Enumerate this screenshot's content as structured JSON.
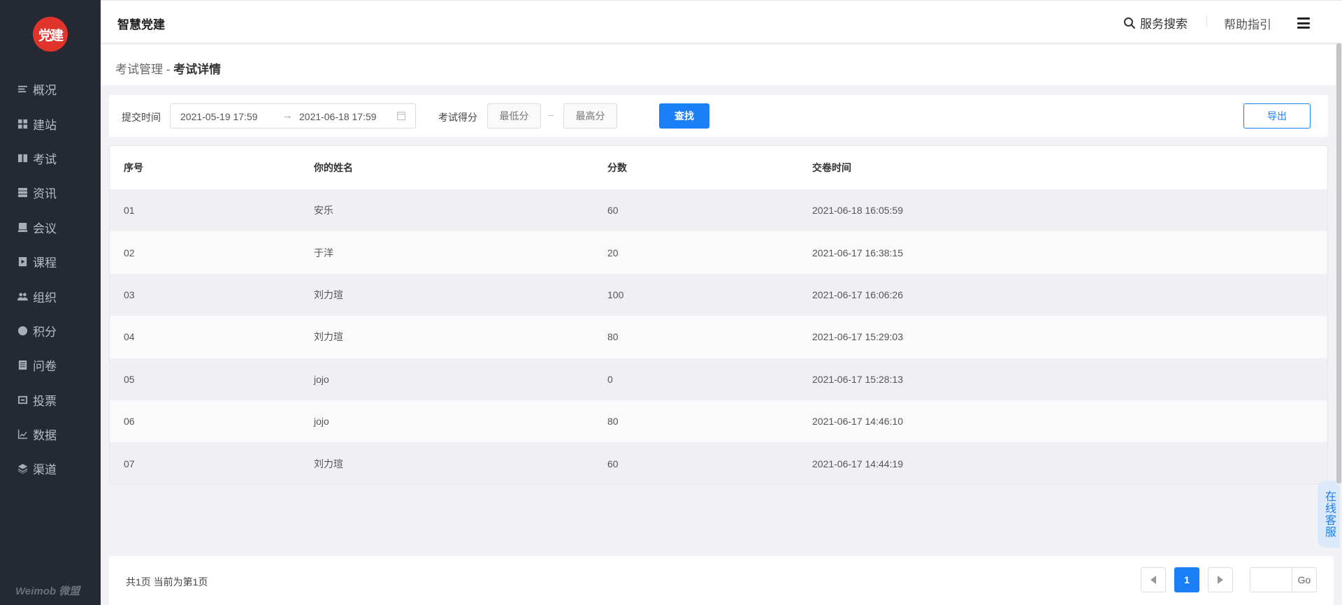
{
  "sidebar": {
    "logo_text": "党建",
    "brand": "Weimob 微盟",
    "items": [
      {
        "label": "概况",
        "icon": "list-icon"
      },
      {
        "label": "建站",
        "icon": "grid-icon"
      },
      {
        "label": "考试",
        "icon": "book-icon"
      },
      {
        "label": "资讯",
        "icon": "news-icon"
      },
      {
        "label": "会议",
        "icon": "meeting-icon"
      },
      {
        "label": "课程",
        "icon": "play-icon"
      },
      {
        "label": "组织",
        "icon": "people-icon"
      },
      {
        "label": "积分",
        "icon": "coin-icon"
      },
      {
        "label": "问卷",
        "icon": "form-icon"
      },
      {
        "label": "投票",
        "icon": "vote-icon"
      },
      {
        "label": "数据",
        "icon": "chart-icon"
      },
      {
        "label": "渠道",
        "icon": "layers-icon"
      }
    ]
  },
  "header": {
    "title": "智慧党建",
    "search_label": "服务搜索",
    "help_label": "帮助指引"
  },
  "breadcrumb": {
    "parent": "考试管理",
    "separator": " - ",
    "current": "考试详情"
  },
  "filter": {
    "submit_time_label": "提交时间",
    "date_start": "2021-05-19 17:59",
    "date_arrow": "→",
    "date_end": "2021-06-18 17:59",
    "score_label": "考试得分",
    "min_placeholder": "最低分",
    "score_dash": "–",
    "max_placeholder": "最高分",
    "search_button": "查找",
    "export_button": "导出"
  },
  "table": {
    "columns": [
      "序号",
      "你的姓名",
      "分数",
      "交卷时间"
    ],
    "rows": [
      [
        "01",
        "安乐",
        "60",
        "2021-06-18 16:05:59"
      ],
      [
        "02",
        "于洋",
        "20",
        "2021-06-17 16:38:15"
      ],
      [
        "03",
        "刘力瑄",
        "100",
        "2021-06-17 16:06:26"
      ],
      [
        "04",
        "刘力瑄",
        "80",
        "2021-06-17 15:29:03"
      ],
      [
        "05",
        "jojo",
        "0",
        "2021-06-17 15:28:13"
      ],
      [
        "06",
        "jojo",
        "80",
        "2021-06-17 14:46:10"
      ],
      [
        "07",
        "刘力瑄",
        "60",
        "2021-06-17 14:44:19"
      ]
    ]
  },
  "pagination": {
    "info": "共1页  当前为第1页",
    "current_page": "1",
    "go_label": "Go"
  },
  "online_service": "在线客服",
  "colors": {
    "sidebar_bg": "#252934",
    "accent": "#1b7ff5",
    "logo_red": "#e0332c"
  }
}
